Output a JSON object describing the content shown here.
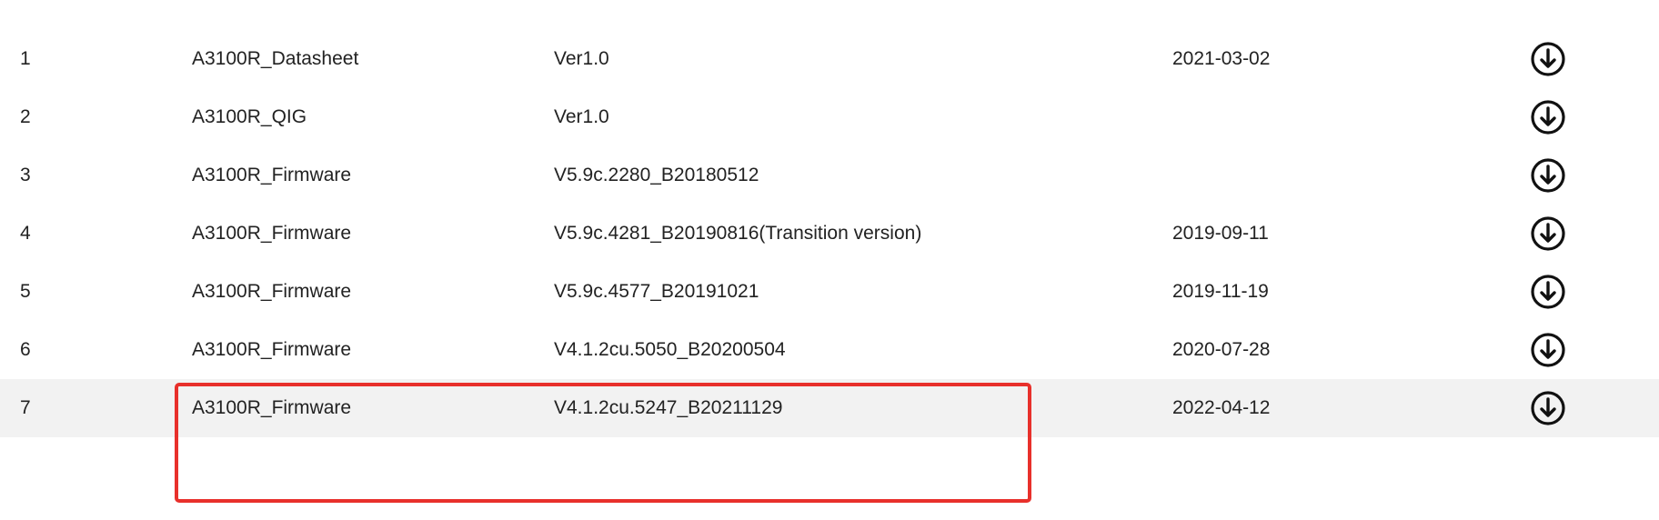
{
  "downloads": {
    "rows": [
      {
        "no": "1",
        "name": "A3100R_Datasheet",
        "version": "Ver1.0",
        "date": "2021-03-02"
      },
      {
        "no": "2",
        "name": "A3100R_QIG",
        "version": "Ver1.0",
        "date": ""
      },
      {
        "no": "3",
        "name": "A3100R_Firmware",
        "version": "V5.9c.2280_B20180512",
        "date": ""
      },
      {
        "no": "4",
        "name": "A3100R_Firmware",
        "version": "V5.9c.4281_B20190816(Transition version)",
        "date": "2019-09-11"
      },
      {
        "no": "5",
        "name": "A3100R_Firmware",
        "version": "V5.9c.4577_B20191021",
        "date": "2019-11-19"
      },
      {
        "no": "6",
        "name": "A3100R_Firmware",
        "version": "V4.1.2cu.5050_B20200504",
        "date": "2020-07-28"
      },
      {
        "no": "7",
        "name": "A3100R_Firmware",
        "version": "V4.1.2cu.5247_B20211129",
        "date": "2022-04-12"
      }
    ],
    "download_icon": "download-arrow-circle-icon",
    "alt_row_color": "#f2f2f2",
    "highlight_color": "#e8302b"
  }
}
